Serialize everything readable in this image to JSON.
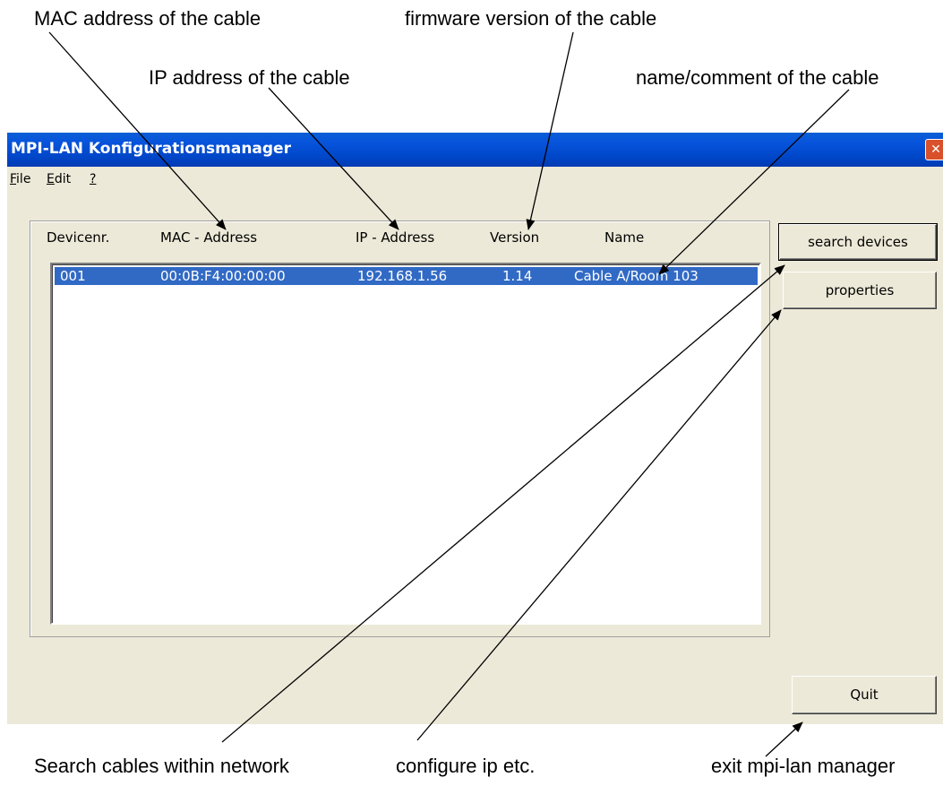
{
  "callouts": {
    "mac": "MAC address of the cable",
    "firmware": "firmware version of the cable",
    "ip": "IP address of the cable",
    "name": "name/comment of the cable",
    "search": "Search cables within network",
    "configure": "configure ip etc.",
    "exit": "exit mpi-lan manager"
  },
  "window": {
    "title": "MPI-LAN Konfigurationsmanager",
    "close_glyph": "✕"
  },
  "menu": {
    "file_m": "F",
    "file_rest": "ile",
    "edit_m": "E",
    "edit_rest": "dit",
    "help_m": "?"
  },
  "table": {
    "headers": [
      "Devicenr.",
      "MAC - Address",
      "IP - Address",
      "Version",
      "Name"
    ],
    "rows": [
      {
        "devicenr": "001",
        "mac": "00:0B:F4:00:00:00",
        "ip": "192.168.1.56",
        "version": "1.14",
        "name": "Cable A/Room 103"
      }
    ]
  },
  "buttons": {
    "search": "search devices",
    "properties": "properties",
    "quit": "Quit"
  },
  "colors": {
    "selection": "#316ac5",
    "titlebar": "#0054e3",
    "window_bg": "#ece9d8"
  }
}
